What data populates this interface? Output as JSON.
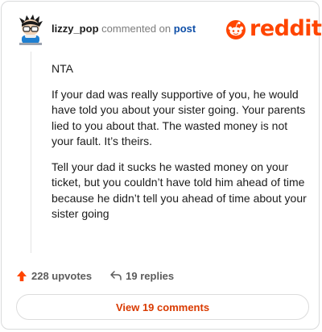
{
  "comment": {
    "username": "lizzy_pop",
    "action_text": "commented on",
    "post_link": "post",
    "paragraphs": [
      "NTA",
      "If your dad was really supportive of you, he would have told you about your sister going. Your parents lied to you about that. The wasted money is not your fault. It’s theirs.",
      "Tell your dad it sucks he wasted money on your ticket, but you couldn’t have told him ahead of time because he didn’t tell you ahead of time about your sister going"
    ]
  },
  "logo": {
    "wordmark": "reddit",
    "icon": "reddit-snoo-icon"
  },
  "footer": {
    "upvotes": "228 upvotes",
    "upvote_icon": "upvote-arrow-icon",
    "replies": "19 replies",
    "reply_icon": "reply-arrow-icon"
  },
  "view_comments_label": "View 19 comments",
  "colors": {
    "brand": "#ff4500",
    "link": "#0f4fa8",
    "button_text": "#d93a00"
  }
}
